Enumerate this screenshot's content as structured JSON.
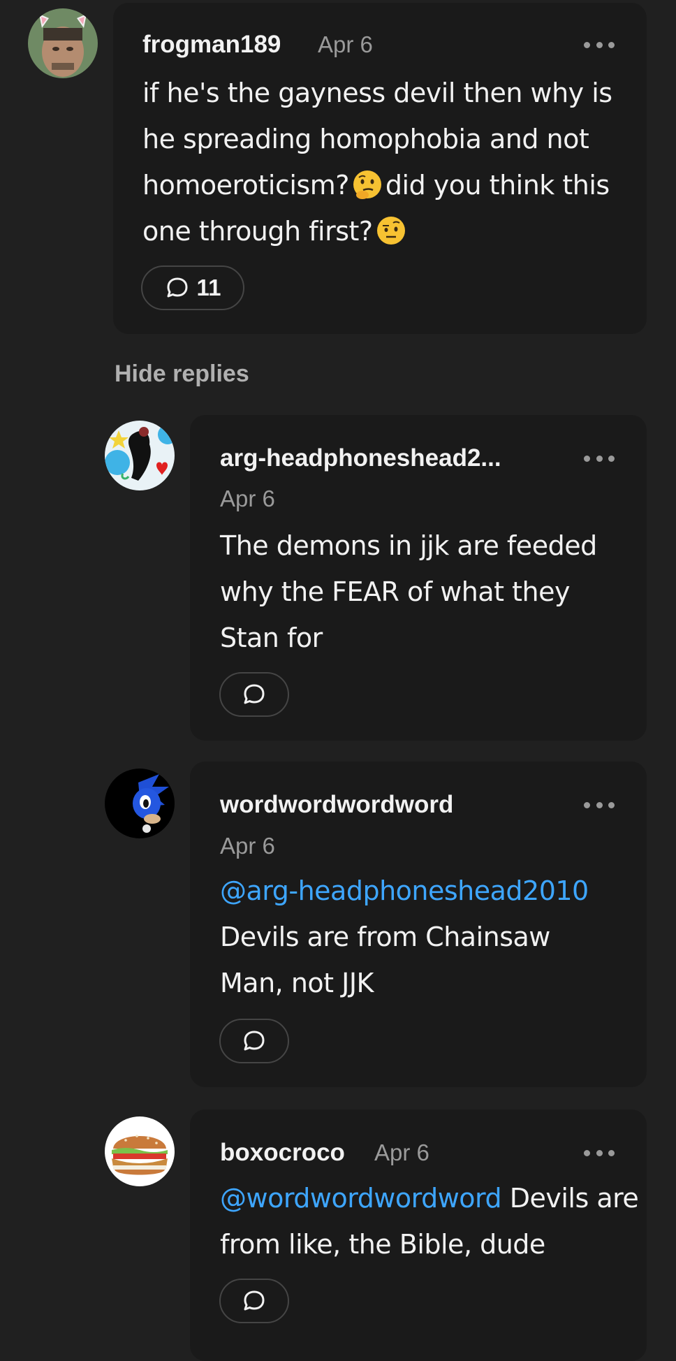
{
  "comments": [
    {
      "username": "frogman189",
      "date": "Apr 6",
      "text_parts": [
        "if he's the gayness devil then why is he spreading homophobia and not homoeroticism?",
        "did you think this one through first?"
      ],
      "reply_count": "11",
      "emojis": [
        "thinking-face-emoji",
        "face-with-raised-eyebrow-emoji"
      ]
    }
  ],
  "hide_replies_label": "Hide replies",
  "replies": [
    {
      "username": "arg-headphoneshead2...",
      "date": "Apr 6",
      "text": "The demons in jjk are feeded why the FEAR of what they Stan for"
    },
    {
      "username": "wordwordwordword",
      "date": "Apr 6",
      "mention": "@arg-headphoneshead2010",
      "text": "Devils are from Chainsaw Man, not JJK"
    },
    {
      "username": "boxocroco",
      "date": "Apr 6",
      "mention": "@wordwordwordword",
      "text": "Devils are from like, the Bible, dude"
    }
  ],
  "colors": {
    "background": "#202020",
    "card": "#1a1a1a",
    "mention": "#3ea6ff",
    "secondary_text": "#9a9a9a"
  }
}
